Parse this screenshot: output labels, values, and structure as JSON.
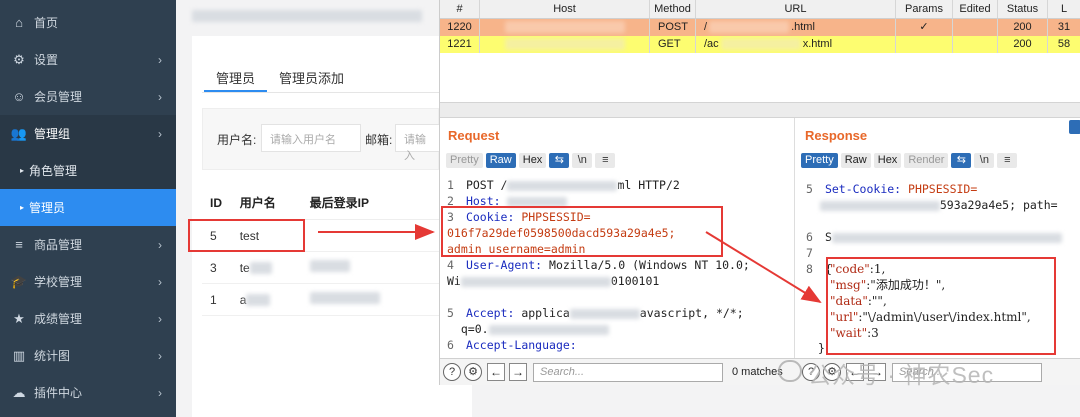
{
  "sidebar": {
    "items": [
      {
        "icon": "home-icon",
        "glyph": "⌂",
        "label": "首页",
        "chevron": ""
      },
      {
        "icon": "gear-icon",
        "glyph": "⚙",
        "label": "设置",
        "chevron": "›"
      },
      {
        "icon": "user-icon",
        "glyph": "☺",
        "label": "会员管理",
        "chevron": "›"
      },
      {
        "icon": "group-icon",
        "glyph": "👥",
        "label": "管理组",
        "chevron": "›"
      }
    ],
    "subitems": [
      {
        "label": "角色管理",
        "tri": "▸"
      },
      {
        "label": "管理员",
        "tri": "▸"
      }
    ],
    "items2": [
      {
        "icon": "list-icon",
        "glyph": "≡",
        "label": "商品管理",
        "chevron": "›"
      },
      {
        "icon": "school-icon",
        "glyph": "🎓",
        "label": "学校管理",
        "chevron": "›"
      },
      {
        "icon": "star-icon",
        "glyph": "★",
        "label": "成绩管理",
        "chevron": "›"
      },
      {
        "icon": "chart-icon",
        "glyph": "▥",
        "label": "统计图",
        "chevron": "›"
      },
      {
        "icon": "cloud-icon",
        "glyph": "☁",
        "label": "插件中心",
        "chevron": "›"
      }
    ]
  },
  "main": {
    "tabs": [
      "管理员",
      "管理员添加"
    ],
    "search": {
      "username_label": "用户名:",
      "username_placeholder": "请输入用户名",
      "email_label": "邮箱:",
      "email_placeholder": "请输入"
    },
    "table": {
      "headers": [
        "ID",
        "用户名",
        "最后登录IP"
      ],
      "rows": [
        {
          "id": "5",
          "username": "test"
        },
        {
          "id": "3",
          "username": "te"
        },
        {
          "id": "1",
          "username": "a"
        }
      ]
    }
  },
  "burp": {
    "columns": [
      "#",
      "Host",
      "Method",
      "URL",
      "Params",
      "Edited",
      "Status",
      "L"
    ],
    "rows": [
      {
        "num": "1220",
        "method": "POST",
        "url_start": "/",
        "url_end": ".html",
        "params": "✓",
        "status": "200",
        "len": "31"
      },
      {
        "num": "1221",
        "method": "GET",
        "url_start": "/ac",
        "url_end": "x.html",
        "params": "",
        "status": "200",
        "len": "58"
      }
    ],
    "request": {
      "title": "Request",
      "buttons": [
        "Pretty",
        "Raw",
        "Hex"
      ],
      "icon_buttons": [
        "⇆",
        "\\n",
        "≡"
      ],
      "lines": {
        "l1_num": "1",
        "l1": "POST /",
        "l1_end": "ml HTTP/2",
        "l2_num": "2",
        "l2": "Host: ",
        "l3_num": "3",
        "l3a_key": "Cookie: ",
        "l3a_val": "PHPSESSID=",
        "l3b": "016f7a29def0598500dacd593a29a4e5;",
        "l3c": "admin_username=admin",
        "l4_num": "4",
        "l4_key": "User-Agent: ",
        "l4_val": "Mozilla/5.0 (Windows NT 10.0;",
        "l4b_start": "Wi",
        "l4b_end": "0100101",
        "l5_num": "5",
        "l5_key": "Accept: ",
        "l5_val": "applica",
        "l5_end": "avascript, */*;",
        "l5b": "q=0.",
        "l6_num": "6",
        "l6_key": "Accept-Language:"
      }
    },
    "response": {
      "title": "Response",
      "buttons": [
        "Pretty",
        "Raw",
        "Hex",
        "Render"
      ],
      "icon_buttons": [
        "⇆",
        "\\n",
        "≡"
      ],
      "l5_num": "5",
      "l5": "Set-Cookie: ",
      "l5_val": "PHPSESSID=",
      "l5b_end": "593a29a4e5; path=",
      "l6_num": "6",
      "l6_start": "S",
      "l7_num": "7",
      "l8_num": "8",
      "l8": "{",
      "json": {
        "code_k": "\"code\"",
        "code_v": ":1,",
        "msg_k": "\"msg\"",
        "msg_v": ":\"添加成功！\",",
        "data_k": "\"data\"",
        "data_v": ":\"\",",
        "url_k": "\"url\"",
        "url_v": ":\"\\/admin\\/user\\/index.html\",",
        "wait_k": "\"wait\"",
        "wait_v": ":3"
      },
      "close": "}"
    },
    "bottom": {
      "search_placeholder": "Search...",
      "matches": "0 matches",
      "search2_placeholder": "Search..."
    }
  },
  "watermark": "公众号 · 神农Sec"
}
